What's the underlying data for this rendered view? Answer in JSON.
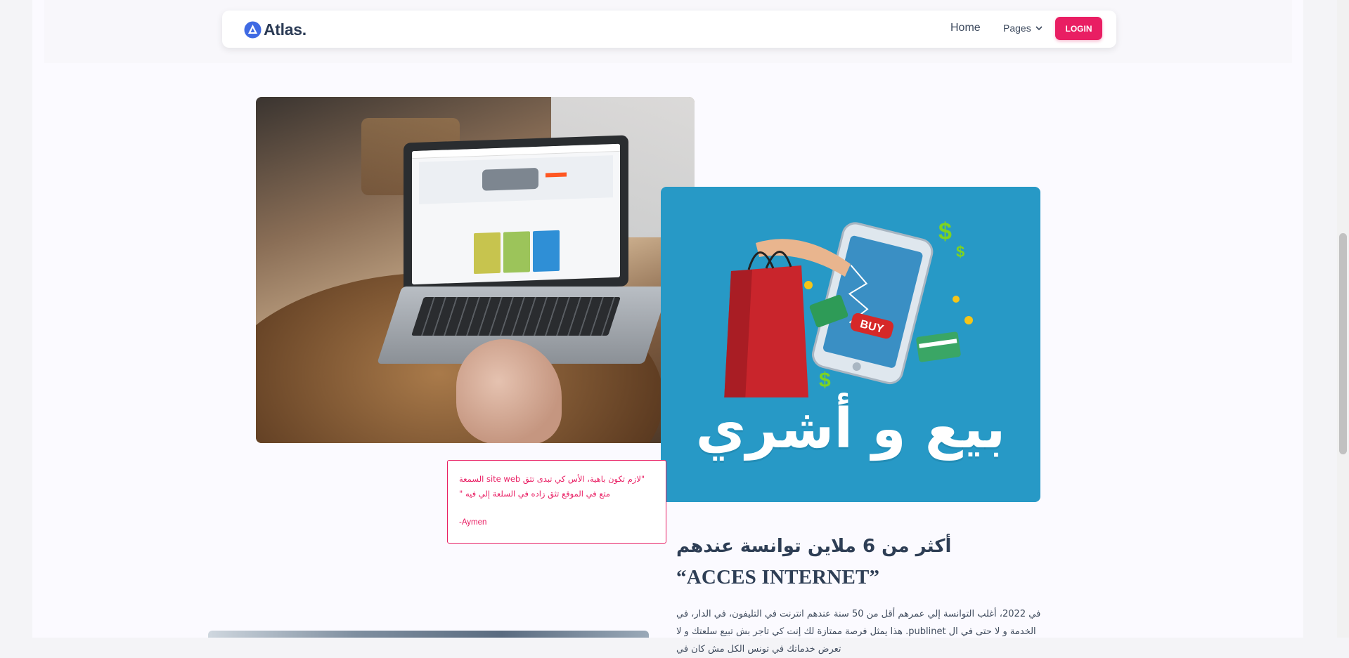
{
  "header": {
    "brand": "Atlas",
    "brand_dot": ".",
    "nav": {
      "home": "Home",
      "pages": "Pages",
      "login": "LOGIN"
    }
  },
  "colors": {
    "accent": "#e91e63",
    "brand_blue": "#3f6ae3",
    "heading": "#2e3e55",
    "illustration_bg": "#2799c6"
  },
  "illustration": {
    "caption": "بيع و أشري",
    "buy_label": "BUY"
  },
  "quote": {
    "text": "\"لازم تكون باهية، الأس كي تبدى تثق site web السمعة متع في الموقع تثق زاده في السلعة إلي فيه \"",
    "author": "-Aymen"
  },
  "section": {
    "heading_line1": "أكثر من 6 ملاين توانسة عندهم",
    "heading_line2": "“ACCES INTERNET”",
    "paragraph": "في 2022، أغلب التوانسة إلي عمرهم أقل من 50 سنة عندهم انترنت في التليفون، في الدار، في الخدمة و لا حتى في ال publinet. هذا يمثل فرصة ممتازة لك إنت كي تاجر بش تبيع سلعتك و لا تعرض خدماتك في تونس الكل مش كان في"
  },
  "icons": [
    "atlas-logo-icon",
    "chevron-down-icon"
  ]
}
